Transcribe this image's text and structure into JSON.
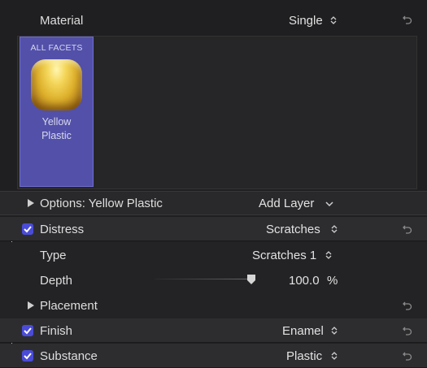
{
  "header": {
    "title": "Material",
    "mode_value": "Single"
  },
  "material": {
    "facets_label": "ALL FACETS",
    "name_line1": "Yellow",
    "name_line2": "Plastic",
    "swatch_color": "#dcae2a"
  },
  "options": {
    "label": "Options: Yellow Plastic",
    "add_layer": "Add Layer"
  },
  "distress": {
    "label": "Distress",
    "value": "Scratches",
    "checked": true
  },
  "type_row": {
    "label": "Type",
    "value": "Scratches 1"
  },
  "depth_row": {
    "label": "Depth",
    "value": "100.0",
    "unit": "%",
    "slider_fraction": 1.0
  },
  "placement": {
    "label": "Placement"
  },
  "finish": {
    "label": "Finish",
    "value": "Enamel",
    "checked": true
  },
  "substance": {
    "label": "Substance",
    "value": "Plastic",
    "checked": true
  },
  "colors": {
    "accent": "#4a4cd8",
    "selected_tile": "#5250a8"
  }
}
